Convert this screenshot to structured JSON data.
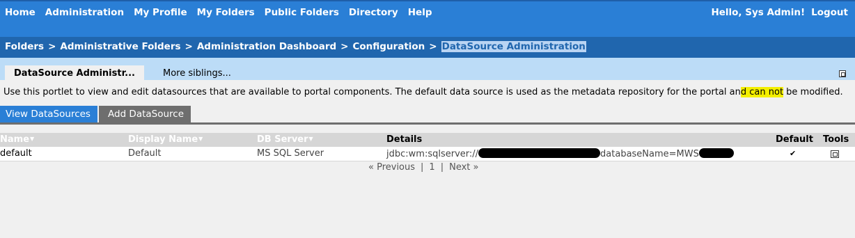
{
  "topnav": {
    "links": [
      "Home",
      "Administration",
      "My Profile",
      "My Folders",
      "Public Folders",
      "Directory",
      "Help"
    ],
    "greeting": "Hello, Sys Admin!",
    "logout": "Logout"
  },
  "breadcrumb": {
    "items": [
      "Folders",
      "Administrative Folders",
      "Administration Dashboard",
      "Configuration"
    ],
    "separator": ">",
    "current": "DataSource Administration"
  },
  "portlet": {
    "active_tab": "DataSource Administr...",
    "more_tab": "More siblings...",
    "description_before": "Use this portlet to view and edit datasources that are available to portal components. The default data source is used as the metadata repository for the portal an",
    "description_highlight": "d can not",
    "description_after": " be modified."
  },
  "subtabs": {
    "view": "View DataSources",
    "add": "Add DataSource"
  },
  "table": {
    "headers": {
      "name": "Name",
      "display_name": "Display Name",
      "db_server": "DB Server",
      "details": "Details",
      "default": "Default",
      "tools": "Tools"
    },
    "rows": [
      {
        "name": "default",
        "display_name": "Default",
        "db_server": "MS SQL Server",
        "details_prefix": "jdbc:wm:sqlserver://",
        "details_mid": "databaseName=MWS",
        "default_mark": "✔"
      }
    ]
  },
  "pager": {
    "previous": "« Previous",
    "page": "1",
    "next": "Next »",
    "divider": "|"
  },
  "colors": {
    "nav_blue": "#2a7fd6",
    "crumb_blue": "#2066ae",
    "portlet_tab_bg": "#bcdcf7",
    "highlight": "#f4ef00"
  }
}
